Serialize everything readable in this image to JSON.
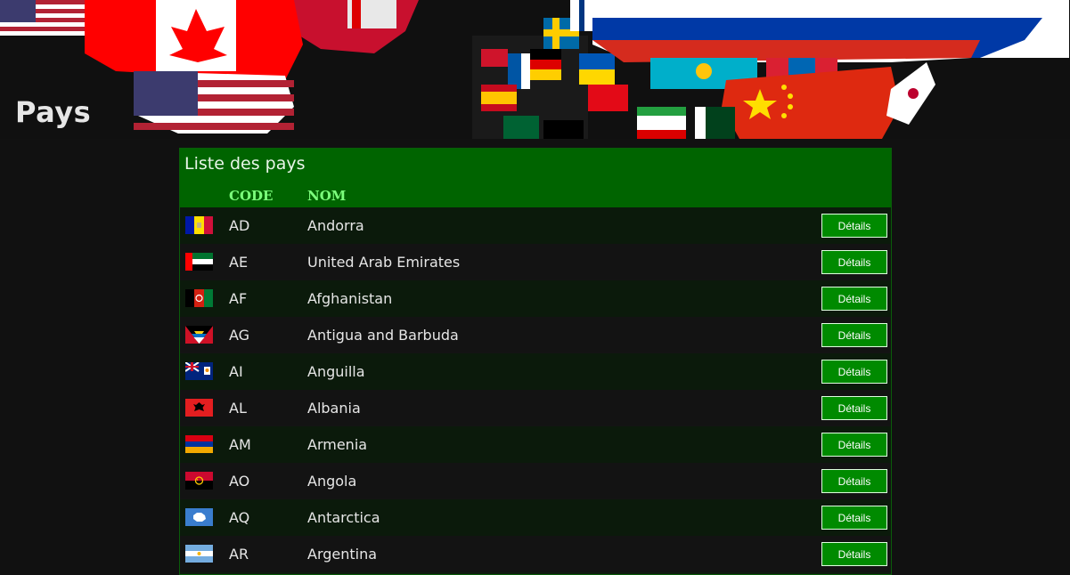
{
  "page": {
    "title": "Pays"
  },
  "banner": {
    "icon": "world-flags-map-banner"
  },
  "table": {
    "title": "Liste des pays",
    "headers": {
      "code": "CODE",
      "name": "NOM"
    },
    "rows": [
      {
        "code": "AD",
        "name": "Andorra",
        "action": "Détails",
        "flag": "andorra-flag-icon"
      },
      {
        "code": "AE",
        "name": "United Arab Emirates",
        "action": "Détails",
        "flag": "uae-flag-icon"
      },
      {
        "code": "AF",
        "name": "Afghanistan",
        "action": "Détails",
        "flag": "afghanistan-flag-icon"
      },
      {
        "code": "AG",
        "name": "Antigua and Barbuda",
        "action": "Détails",
        "flag": "antigua-flag-icon"
      },
      {
        "code": "AI",
        "name": "Anguilla",
        "action": "Détails",
        "flag": "anguilla-flag-icon"
      },
      {
        "code": "AL",
        "name": "Albania",
        "action": "Détails",
        "flag": "albania-flag-icon"
      },
      {
        "code": "AM",
        "name": "Armenia",
        "action": "Détails",
        "flag": "armenia-flag-icon"
      },
      {
        "code": "AO",
        "name": "Angola",
        "action": "Détails",
        "flag": "angola-flag-icon"
      },
      {
        "code": "AQ",
        "name": "Antarctica",
        "action": "Détails",
        "flag": "antarctica-flag-icon"
      },
      {
        "code": "AR",
        "name": "Argentina",
        "action": "Détails",
        "flag": "argentina-flag-icon"
      }
    ]
  },
  "colors": {
    "background": "#111111",
    "header_green": "#006400",
    "button_green": "#008a00",
    "header_text": "#7cff7c"
  }
}
